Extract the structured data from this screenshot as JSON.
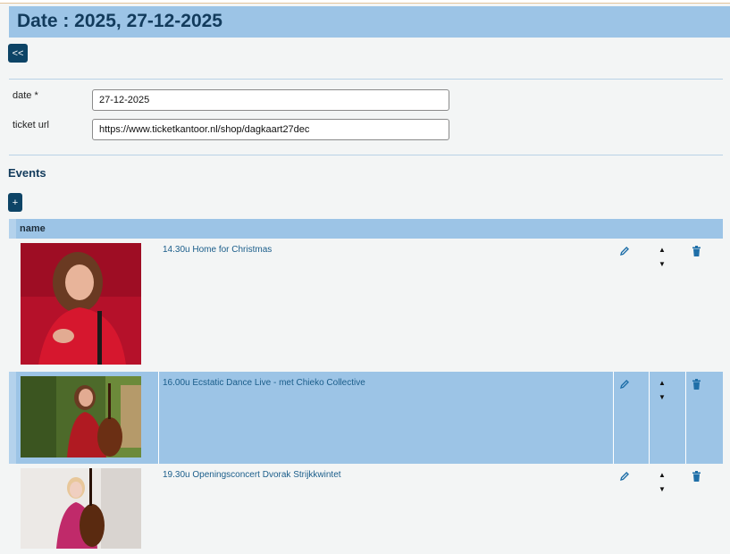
{
  "page": {
    "title": "Date : 2025, 27-12-2025"
  },
  "nav": {
    "back_label": "<<"
  },
  "form": {
    "date_label": "date *",
    "date_value": "27-12-2025",
    "ticket_label": "ticket url",
    "ticket_value": "https://www.ticketkantoor.nl/shop/dagkaart27dec"
  },
  "events": {
    "title": "Events",
    "add_label": "+",
    "column_name": "name",
    "rows": [
      {
        "name": "14.30u Home for Christmas"
      },
      {
        "name": "16.00u Ecstatic Dance Live - met Chieko Collective"
      },
      {
        "name": "19.30u Openingsconcert Dvorak Strijkkwintet"
      }
    ]
  },
  "icons": {
    "edit": "pencil-icon",
    "up": "arrow-up-icon",
    "down": "arrow-down-icon",
    "delete": "trash-icon"
  },
  "colors": {
    "header_bg": "#9cc4e6",
    "button_dark": "#0d4466",
    "link": "#1a5d8a",
    "icon_blue": "#1f6fa8"
  }
}
